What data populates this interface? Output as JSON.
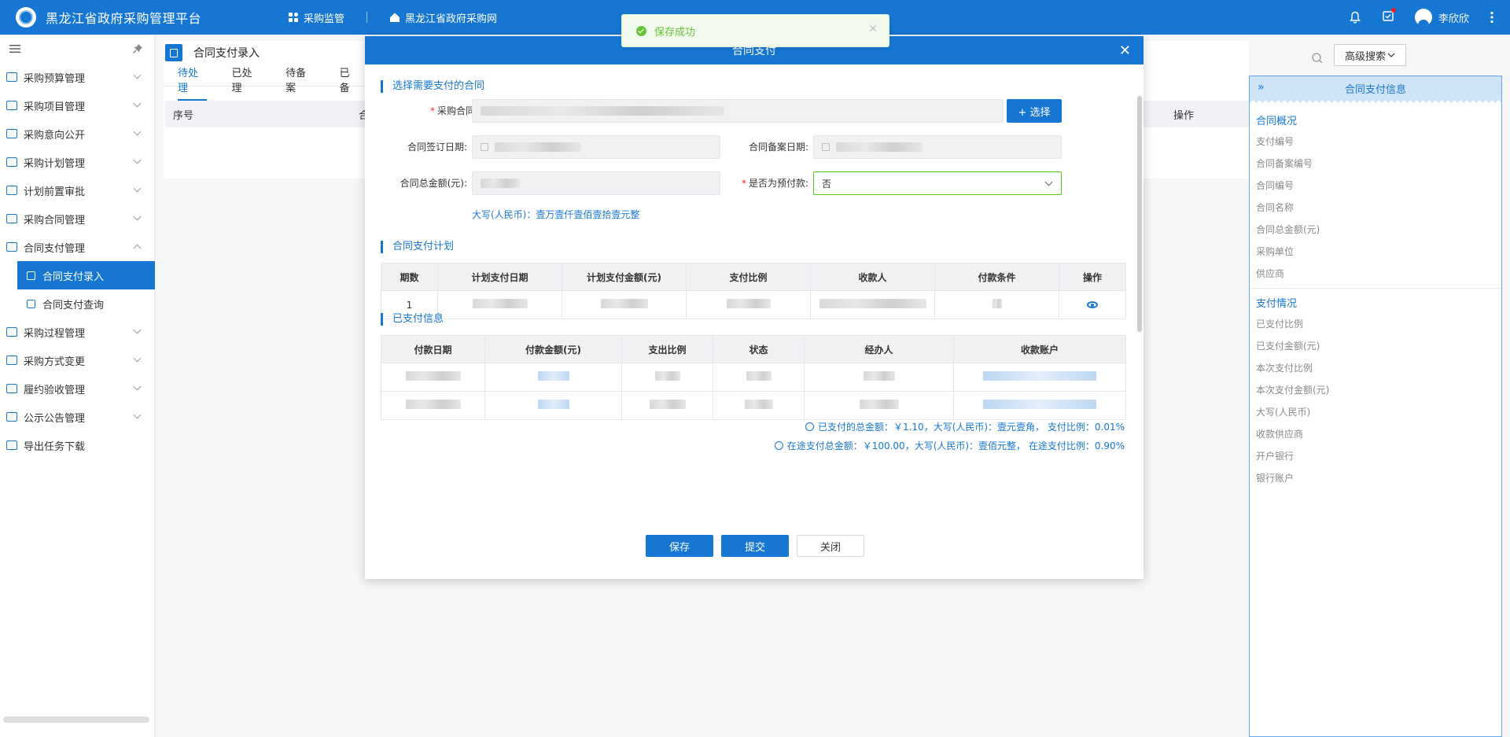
{
  "app": {
    "title": "黑龙江省政府采购管理平台"
  },
  "topnav": [
    {
      "label": "采购监管",
      "icon": "grid-icon"
    },
    {
      "label": "黑龙江省政府采购网",
      "icon": "home-icon"
    }
  ],
  "user": {
    "name": "李欣欣"
  },
  "sidebar": {
    "items": [
      {
        "label": "采购预算管理"
      },
      {
        "label": "采购项目管理"
      },
      {
        "label": "采购意向公开"
      },
      {
        "label": "采购计划管理"
      },
      {
        "label": "计划前置审批"
      },
      {
        "label": "采购合同管理"
      },
      {
        "label": "合同支付管理"
      }
    ],
    "subitems": [
      {
        "label": "合同支付录入"
      },
      {
        "label": "合同支付查询"
      }
    ],
    "items_after": [
      {
        "label": "采购过程管理"
      },
      {
        "label": "采购方式变更"
      },
      {
        "label": "履约验收管理"
      },
      {
        "label": "公示公告管理"
      },
      {
        "label": "导出任务下载"
      }
    ]
  },
  "page": {
    "title": "合同支付录入",
    "tabs": [
      "待处理",
      "已处理",
      "待备案",
      "已备"
    ],
    "table_headers": {
      "seq": "序号",
      "col2": "合",
      "ops": "操作"
    },
    "advanced_search": "高级搜索"
  },
  "toast": {
    "message": "保存成功"
  },
  "modal": {
    "title": "合同支付",
    "sections": {
      "select_contract": "选择需要支付的合同",
      "plan": "合同支付计划",
      "paid": "已支付信息"
    },
    "fields": {
      "contract_label": "采购合同:",
      "select_button": "+ 选择",
      "sign_date_label": "合同签订日期:",
      "record_date_label": "合同备案日期:",
      "total_label": "合同总金额(元):",
      "prepay_label": "是否为预付款:",
      "prepay_value": "否",
      "amount_cn": "大写(人民币)：壹万壹仟壹佰壹拾壹元整"
    },
    "plan_table": {
      "headers": [
        "期数",
        "计划支付日期",
        "计划支付金额(元)",
        "支付比例",
        "收款人",
        "付款条件",
        "操作"
      ],
      "rows": [
        {
          "period": "1"
        }
      ]
    },
    "paid_table": {
      "headers": [
        "付款日期",
        "付款金额(元)",
        "支出比例",
        "状态",
        "经办人",
        "收款账户"
      ]
    },
    "summary": {
      "paid": "已支付的总金额：￥1.10，大写(人民币)：壹元壹角，  支付比例：0.01%",
      "in_transit": "在途支付总金额：￥100.00，大写(人民币)：壹佰元整，  在途支付比例：0.90%"
    },
    "buttons": {
      "save": "保存",
      "submit": "提交",
      "close": "关闭"
    }
  },
  "rpanel": {
    "title": "合同支付信息",
    "overview_title": "合同概况",
    "overview_items": [
      "支付编号",
      "合同备案编号",
      "合同编号",
      "合同名称",
      "合同总金额(元)",
      "采购单位",
      "供应商"
    ],
    "payment_title": "支付情况",
    "payment_items": [
      "已支付比例",
      "已支付金额(元)",
      "本次支付比例",
      "本次支付金额(元)",
      "大写(人民币)",
      "收款供应商",
      "开户银行",
      "银行账户"
    ]
  }
}
